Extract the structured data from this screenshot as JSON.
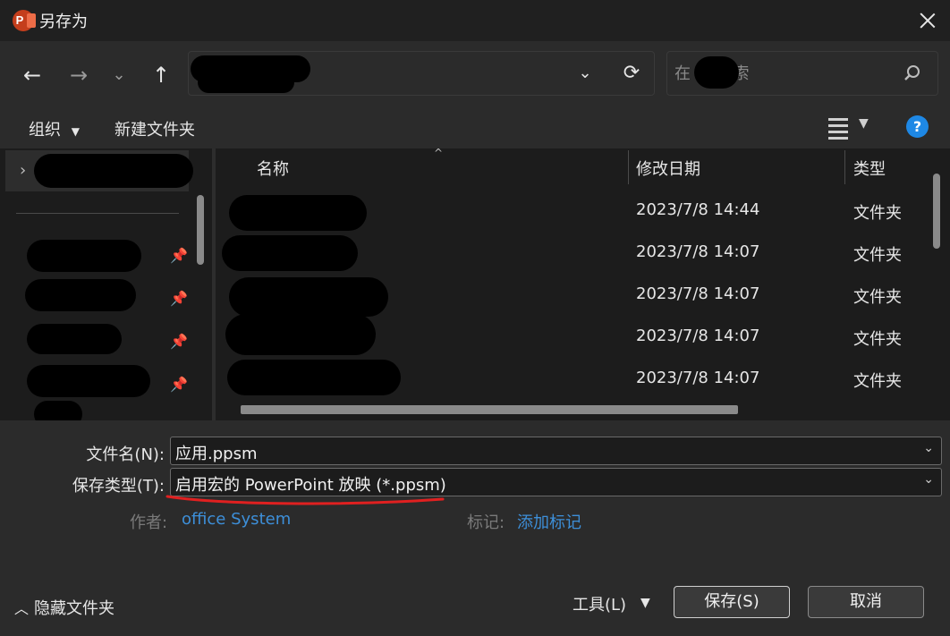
{
  "window": {
    "title": "另存为"
  },
  "nav": {
    "back": "←",
    "forward": "→",
    "recent": "⌄",
    "up": "↑",
    "address_dropdown": "⌄",
    "refresh": "⟳"
  },
  "search": {
    "placeholder": "在  中搜索"
  },
  "toolbar": {
    "organize": "组织",
    "new_folder": "新建文件夹",
    "help": "?"
  },
  "file_list": {
    "columns": {
      "name": "名称",
      "modified": "修改日期",
      "type": "类型"
    },
    "rows": [
      {
        "date": "2023/7/8 14:44",
        "type": "文件夹"
      },
      {
        "date": "2023/7/8 14:07",
        "type": "文件夹"
      },
      {
        "date": "2023/7/8 14:07",
        "type": "文件夹"
      },
      {
        "date": "2023/7/8 14:07",
        "type": "文件夹"
      },
      {
        "date": "2023/7/8 14:07",
        "type": "文件夹"
      }
    ]
  },
  "form": {
    "filename_label": "文件名(N):",
    "filename_value": "应用.ppsm",
    "filetype_label": "保存类型(T):",
    "filetype_value": "启用宏的 PowerPoint 放映 (*.ppsm)",
    "author_label": "作者:",
    "author_value": "office System",
    "tags_label": "标记:",
    "tags_value": "添加标记"
  },
  "footer": {
    "hide_folders": "隐藏文件夹",
    "tools": "工具(L)",
    "save": "保存(S)",
    "cancel": "取消"
  },
  "colors": {
    "accent": "#1e88e5",
    "link": "#3d8fd9",
    "annotation": "#e02020",
    "app_icon": "#c43e1c"
  }
}
